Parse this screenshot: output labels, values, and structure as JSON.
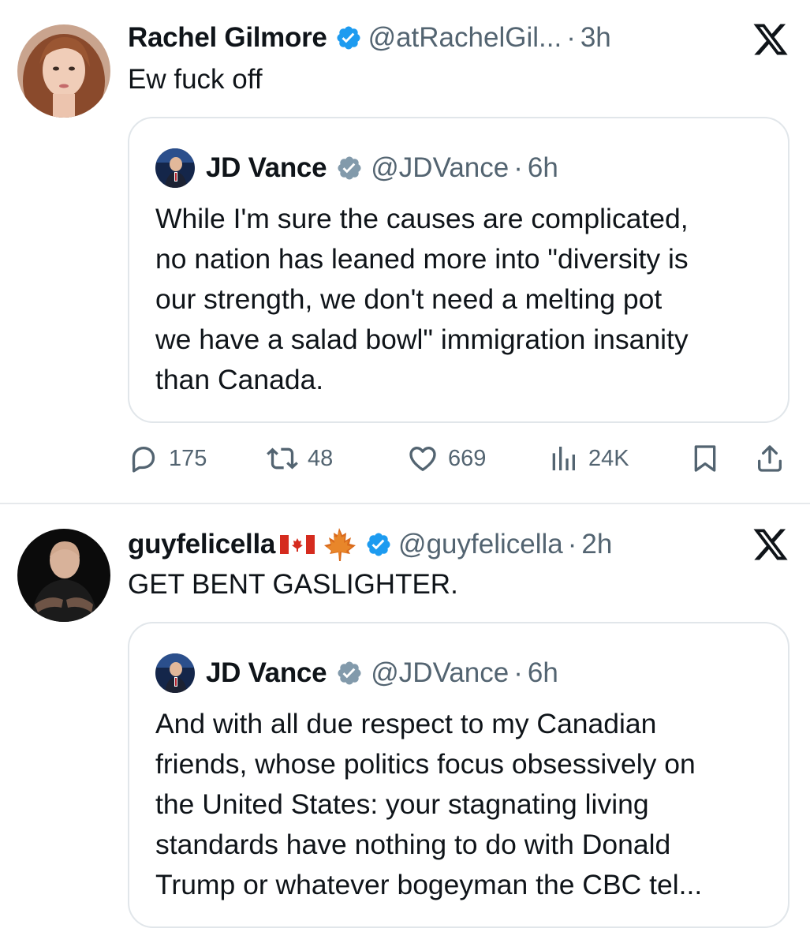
{
  "tweets": [
    {
      "author_name": "Rachel Gilmore",
      "handle": "@atRachelGil...",
      "separator": "·",
      "time": "3h",
      "text": "Ew fuck off",
      "platform_icon": "x-logo-icon",
      "quoted": {
        "author_name": "JD Vance",
        "handle": "@JDVance",
        "separator": "·",
        "time": "6h",
        "text": "While I'm sure the causes are complicated,\nno nation has leaned more into \"diversity is\nour strength, we don't need a melting pot\nwe have a salad bowl\" immigration insanity\nthan Canada."
      },
      "stats": {
        "replies": "175",
        "reposts": "48",
        "likes": "669",
        "views": "24K"
      }
    },
    {
      "author_name": "guyfelicella",
      "name_emoji": [
        "canada-flag-icon",
        "maple-leaf-icon"
      ],
      "handle": "@guyfelicella",
      "separator": "·",
      "time": "2h",
      "text": "GET BENT GASLIGHTER.",
      "platform_icon": "x-logo-icon",
      "quoted": {
        "author_name": "JD Vance",
        "handle": "@JDVance",
        "separator": "·",
        "time": "6h",
        "text": "And with all due respect to my Canadian\nfriends, whose politics focus obsessively on\nthe United States: your stagnating living\nstandards have nothing to do with Donald\nTrump or whatever bogeyman the CBC tel..."
      }
    }
  ],
  "colors": {
    "verified_blue": "#1d9bf0",
    "verified_gray": "#829aab",
    "secondary_text": "#536471",
    "border": "#e1e6ea"
  }
}
